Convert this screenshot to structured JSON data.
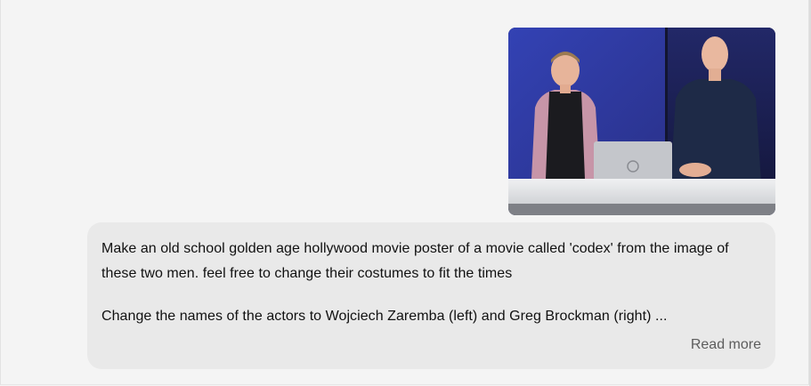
{
  "message": {
    "paragraph1": "Make an old school golden age hollywood movie poster of a movie called 'codex' from the image of these two men. feel free to change their costumes to fit the times",
    "paragraph2": "Change the names of the actors to Wojciech Zaremba (left) and Greg Brockman (right) ...",
    "read_more_label": "Read more"
  },
  "attachment": {
    "icon": "photo-thumbnail",
    "colors": {
      "backdrop_left": "#2f3a9e",
      "backdrop_right": "#1c2160",
      "desk": "#e6e7ea"
    }
  }
}
